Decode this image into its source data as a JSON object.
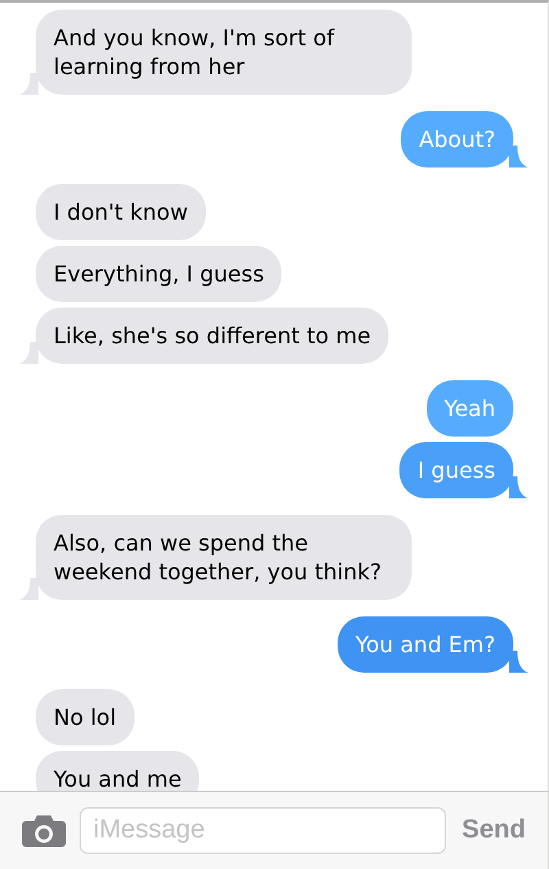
{
  "messages": [
    {
      "kind": "incoming",
      "text": "And you know, I'm sort of learning from her",
      "tail": true
    },
    {
      "kind": "outgoing",
      "text": "About?",
      "tail": true
    },
    {
      "kind": "incoming",
      "text": "I don't know",
      "tail": false
    },
    {
      "kind": "incoming",
      "text": "Everything, I guess",
      "tail": false
    },
    {
      "kind": "incoming",
      "text": "Like, she's so different to me",
      "tail": true
    },
    {
      "kind": "outgoing",
      "text": "Yeah",
      "tail": false
    },
    {
      "kind": "outgoing",
      "text": "I guess",
      "tail": true
    },
    {
      "kind": "incoming",
      "text": "Also, can we spend the weekend together, you think?",
      "tail": true
    },
    {
      "kind": "outgoing",
      "text": "You and Em?",
      "tail": true
    },
    {
      "kind": "incoming",
      "text": "No lol",
      "tail": false
    },
    {
      "kind": "incoming",
      "text": "You and me",
      "tail": false
    }
  ],
  "composer": {
    "placeholder": "iMessage",
    "send": "Send"
  }
}
